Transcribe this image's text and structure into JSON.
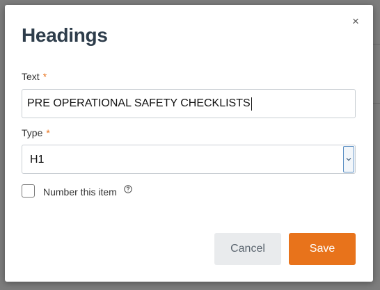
{
  "dialog": {
    "title": "Headings",
    "close_symbol": "×"
  },
  "form": {
    "text_label": "Text",
    "text_required_mark": "*",
    "text_value": "PRE OPERATIONAL SAFETY CHECKLISTS",
    "type_label": "Type",
    "type_required_mark": "*",
    "type_selected": "H1",
    "number_item_label": "Number this item",
    "number_item_checked": false
  },
  "buttons": {
    "cancel": "Cancel",
    "save": "Save"
  },
  "colors": {
    "accent": "#e8731b",
    "title": "#2e3d4b",
    "required": "#e8711b"
  },
  "icons": {
    "close": "close-icon",
    "dropdown": "chevron-down-icon",
    "help": "help-circle-icon"
  }
}
